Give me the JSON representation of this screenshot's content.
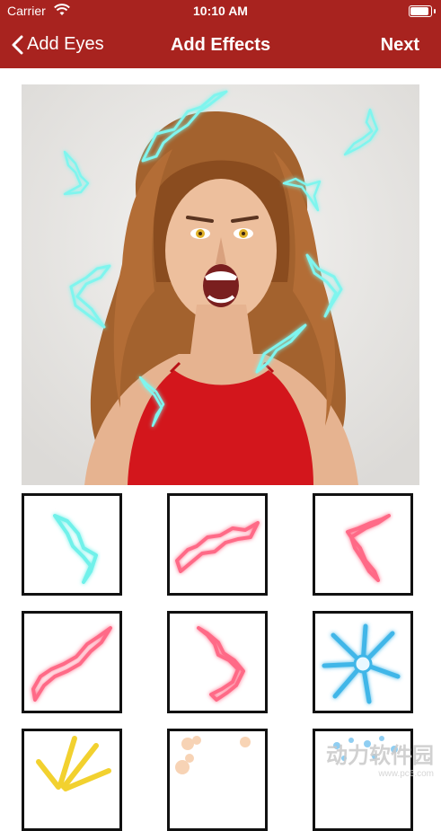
{
  "status": {
    "carrier": "Carrier",
    "time": "10:10 AM"
  },
  "nav": {
    "back_label": "Add Eyes",
    "title": "Add Effects",
    "next_label": "Next"
  },
  "preview": {
    "effect_color": "#7ff5ee"
  },
  "effects": [
    {
      "name": "effect-cyan-lightning",
      "color": "#6ff1ea"
    },
    {
      "name": "effect-pink-lightning-wide",
      "color": "#ff6b87"
    },
    {
      "name": "effect-pink-lightning-bent",
      "color": "#ff6b87"
    },
    {
      "name": "effect-pink-lightning-long",
      "color": "#ff6b87"
    },
    {
      "name": "effect-pink-lightning-hook",
      "color": "#ff6b87"
    },
    {
      "name": "effect-blue-burst",
      "color": "#3fb6e8"
    },
    {
      "name": "effect-yellow-burst",
      "color": "#f2d12f"
    },
    {
      "name": "effect-peach-smoke",
      "color": "#f6c9a3"
    },
    {
      "name": "effect-blue-particles",
      "color": "#7cc6f0"
    }
  ],
  "watermark": {
    "text": "动力软件园",
    "subtext": "www.pc6.com"
  }
}
